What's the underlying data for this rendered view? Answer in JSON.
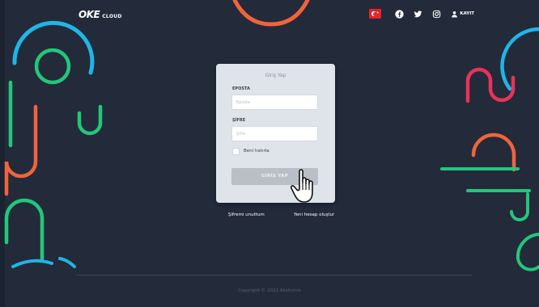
{
  "header": {
    "logo_mark": "OKE",
    "logo_sub": "CLOUD",
    "signup_label": "KAYIT",
    "icons": [
      "turkey-flag-icon",
      "facebook-icon",
      "twitter-icon",
      "instagram-icon",
      "user-icon"
    ]
  },
  "login": {
    "title": "Giriş Yap",
    "email_label": "EPOSTA",
    "email_placeholder": "Eposta",
    "email_value": "",
    "password_label": "ŞİFRE",
    "password_placeholder": "Şifre",
    "password_value": "",
    "remember_label": "Beni hatırla",
    "remember_checked": false,
    "submit_label": "GİRİŞ YAP"
  },
  "links": {
    "forgot_password": "Şifremi unuttum",
    "create_account": "Yeni hesap oluştur"
  },
  "footer": {
    "copyright": "Copyright © 2022 Aketronik"
  },
  "colors": {
    "background": "#232a3a",
    "card": "#dfe3ea",
    "button": "#b9bec7",
    "deco_blue": "#1fb6e6",
    "deco_green": "#22c77a",
    "deco_orange": "#f0643c",
    "deco_red": "#e8335a"
  }
}
